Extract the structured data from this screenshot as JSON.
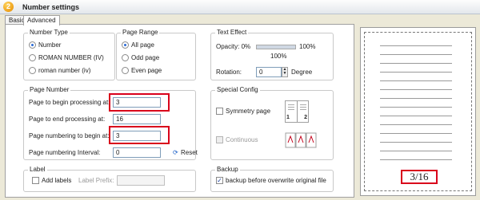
{
  "window": {
    "title": "Number settings",
    "icon_glyph": "2"
  },
  "tabs": [
    {
      "label": "Basic"
    },
    {
      "label": "Advanced"
    }
  ],
  "number_type": {
    "title": "Number Type",
    "options": [
      {
        "label": "Number",
        "selected": true
      },
      {
        "label": "ROMAN NUMBER (IV)",
        "selected": false
      },
      {
        "label": "roman number (iv)",
        "selected": false
      }
    ]
  },
  "page_range": {
    "title": "Page Range",
    "options": [
      {
        "label": "All page",
        "selected": true
      },
      {
        "label": "Odd page",
        "selected": false
      },
      {
        "label": "Even page",
        "selected": false
      }
    ]
  },
  "text_effect": {
    "title": "Text Effect",
    "opacity_label": "Opacity: 0%",
    "opacity_max": "100%",
    "opacity_value": "100%",
    "opacity_fraction": 1.0,
    "rotation_label": "Rotation:",
    "rotation_value": "0",
    "rotation_unit": "Degree"
  },
  "page_number": {
    "title": "Page Number",
    "begin_processing_label": "Page to begin processing at:",
    "begin_processing_value": "3",
    "end_processing_label": "Page to end processing at:",
    "end_processing_value": "16",
    "numbering_begin_label": "Page numbering to begin at:",
    "numbering_begin_value": "3",
    "numbering_interval_label": "Page numbering Interval:",
    "numbering_interval_value": "0",
    "reset_label": "Reset"
  },
  "special_config": {
    "title": "Special Config",
    "symmetry_label": "Symmetry page",
    "symmetry_checked": false,
    "continuous_label": "Continuous",
    "continuous_checked": false,
    "symmetry_pages": [
      "1",
      "2"
    ]
  },
  "label_group": {
    "title": "Label",
    "add_labels_label": "Add labels",
    "add_labels_checked": false,
    "prefix_label": "Label Prefix:",
    "prefix_value": ""
  },
  "backup": {
    "title": "Backup",
    "option_label": "backup before overwrite original file",
    "checked": true,
    "check_glyph": "✓"
  },
  "preview": {
    "page_indicator": "3/16"
  },
  "colors": {
    "highlight_red": "#d9001b",
    "radio_blue": "#2a6ad6"
  }
}
